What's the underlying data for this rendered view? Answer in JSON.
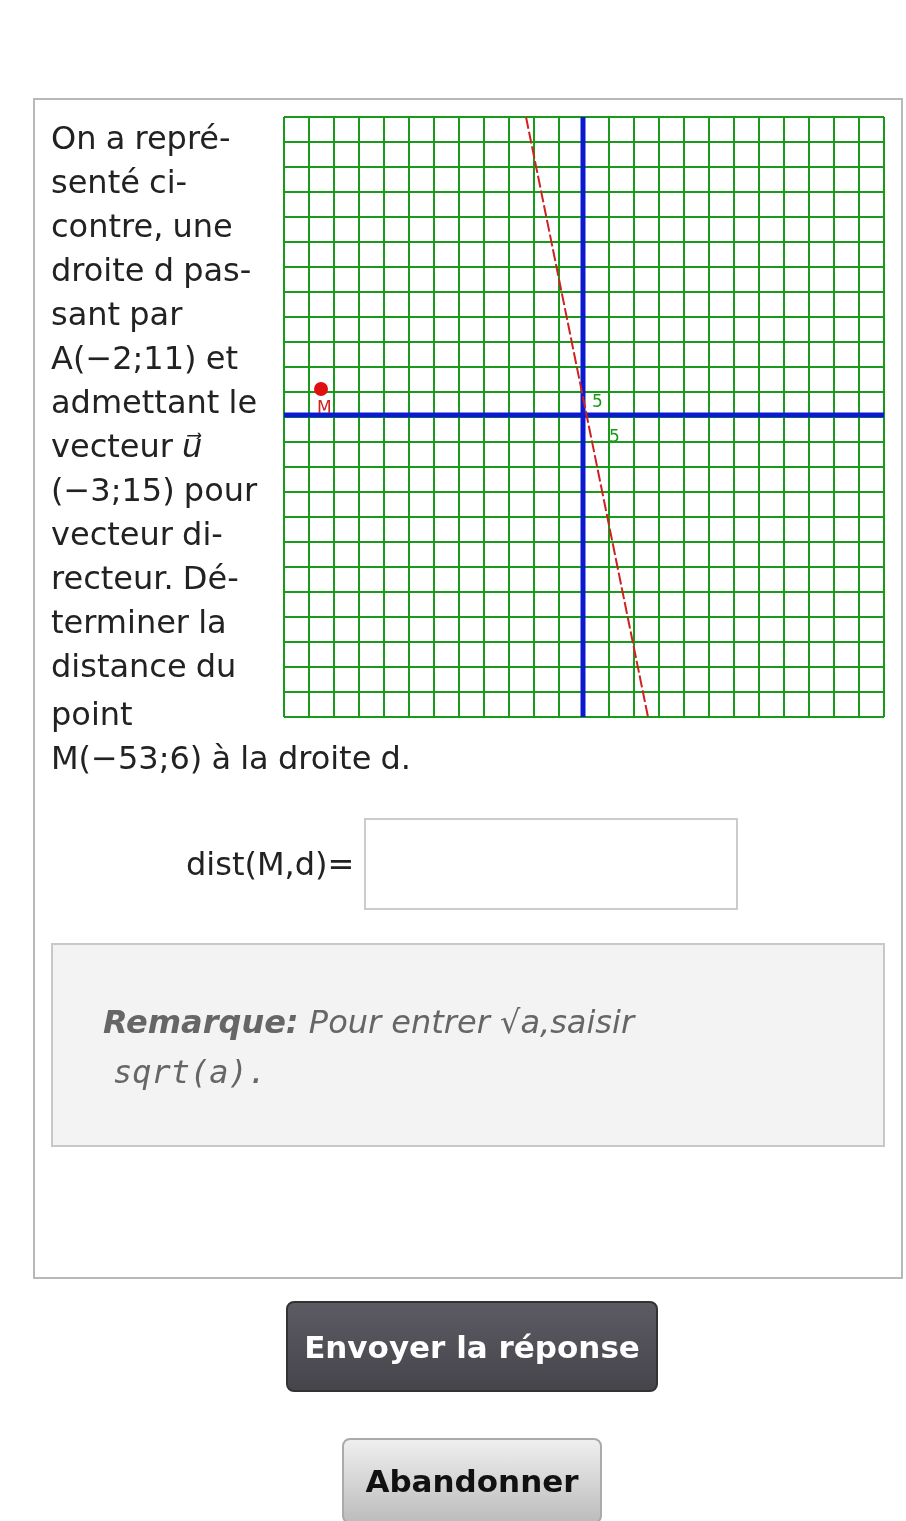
{
  "exercise": {
    "statement": "On a repré-\nsenté ci-\ncontre, une\ndroite d pas-\nsant par\nA(−2;11) et\nadmettant le\nvecteur *u⃗*\n(−3;15) pour\nvecteur di-\nrecteur. Dé-\nterminer la\ndistance du",
    "statement_end": "point\nM(−53;6) à la droite d.",
    "graph": {
      "point_label": "M",
      "x_tick_label": "5",
      "y_tick_label": "5"
    },
    "answer": {
      "label": "dist(M,d)="
    },
    "remark": {
      "text": "**Remarque:** Pour entrer √*a*,saisir",
      "code": "sqrt(a)."
    }
  },
  "buttons": [
    {
      "label": "Envoyer la réponse",
      "kind": "primary"
    },
    {
      "label": "Abandonner",
      "kind": "secondary"
    }
  ]
}
